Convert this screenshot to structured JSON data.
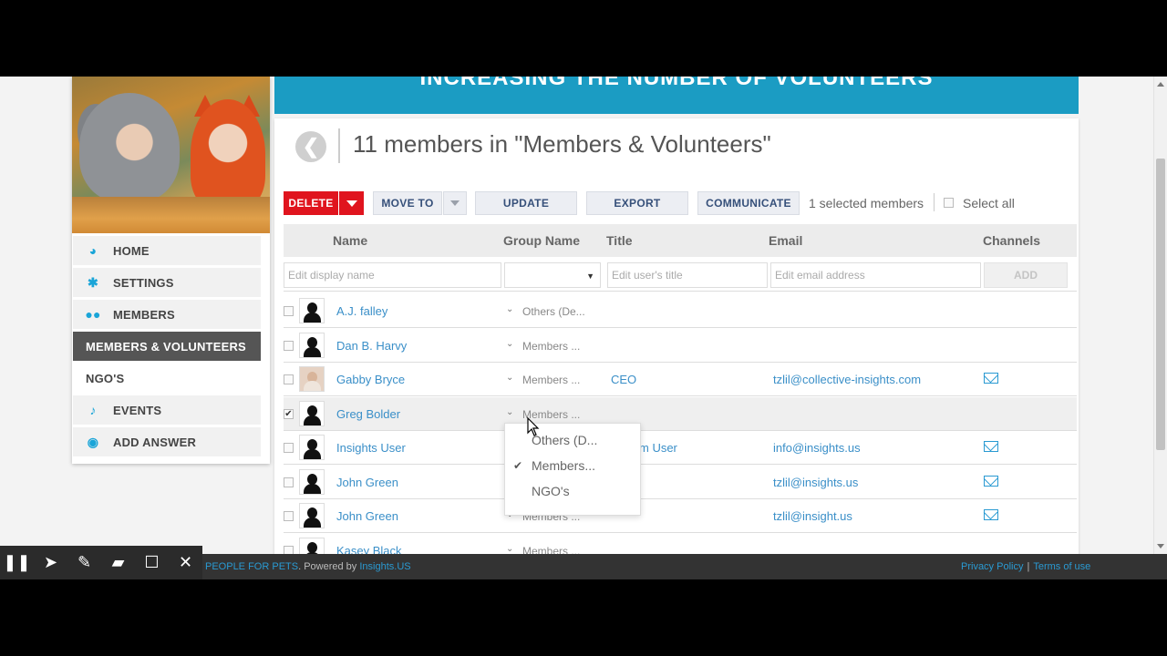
{
  "banner": {
    "title": "INCREASING THE NUMBER OF VOLUNTEERS"
  },
  "sidebar": {
    "items": [
      {
        "label": "HOME",
        "icon": "dashboard-icon",
        "active": false
      },
      {
        "label": "SETTINGS",
        "icon": "gear-icon",
        "active": false
      },
      {
        "label": "MEMBERS",
        "icon": "users-icon",
        "active": false
      },
      {
        "label": "MEMBERS & VOLUNTEERS",
        "icon": "",
        "active": true
      },
      {
        "label": "NGO'S",
        "icon": "",
        "active": false
      },
      {
        "label": "EVENTS",
        "icon": "microphone-icon",
        "active": false
      },
      {
        "label": "ADD ANSWER",
        "icon": "chat-icon",
        "active": false
      }
    ]
  },
  "panel": {
    "title": "11 members in \"Members & Volunteers\"",
    "toolbar": {
      "delete": "DELETE",
      "move_to": "MOVE TO",
      "update": "UPDATE",
      "export": "EXPORT",
      "communicate": "COMMUNICATE",
      "selected_count": "1 selected members",
      "select_all": "Select all"
    },
    "columns": {
      "name": "Name",
      "group": "Group Name",
      "title": "Title",
      "email": "Email",
      "channels": "Channels"
    },
    "edit_row": {
      "name_placeholder": "Edit display name",
      "title_placeholder": "Edit user's title",
      "email_placeholder": "Edit email address",
      "add": "ADD"
    },
    "rows": [
      {
        "name": "A.J. falley",
        "group": "Others (De...",
        "title": "",
        "email": "",
        "checked": false,
        "photo": false,
        "mail": false
      },
      {
        "name": "Dan B. Harvy",
        "group": "Members ...",
        "title": "",
        "email": "",
        "checked": false,
        "photo": false,
        "mail": false
      },
      {
        "name": "Gabby Bryce",
        "group": "Members ...",
        "title": "CEO",
        "email": "tzlil@collective-insights.com",
        "checked": false,
        "photo": true,
        "mail": true
      },
      {
        "name": "Greg Bolder",
        "group": "Members ...",
        "title": "",
        "email": "",
        "checked": true,
        "photo": false,
        "mail": false
      },
      {
        "name": "Insights User",
        "group": "",
        "title": "m User",
        "email": "info@insights.us",
        "checked": false,
        "photo": false,
        "mail": true
      },
      {
        "name": "John Green",
        "group": "",
        "title": "",
        "email": "tzlil@insights.us",
        "checked": false,
        "photo": false,
        "mail": true
      },
      {
        "name": "John Green",
        "group": "Members ...",
        "title": "",
        "email": "tzlil@insight.us",
        "checked": false,
        "photo": false,
        "mail": true
      },
      {
        "name": "Kasey Black",
        "group": "Members ...",
        "title": "",
        "email": "",
        "checked": false,
        "photo": false,
        "mail": false
      }
    ],
    "group_dropdown": {
      "options": [
        "Others (D...",
        "Members...",
        "NGO's"
      ],
      "selected": "Members..."
    }
  },
  "footer": {
    "org_link": "PEOPLE FOR PETS",
    "powered_by": ". Powered by ",
    "powered_link": "Insights.US",
    "privacy": "Privacy Policy",
    "separator": "|",
    "terms": "Terms of use"
  },
  "annotation_tools": [
    "pause-icon",
    "pointer-icon",
    "pen-icon",
    "highlighter-icon",
    "rectangle-icon",
    "close-icon"
  ],
  "colors": {
    "banner": "#1b9cc3",
    "delete": "#e0141e",
    "link": "#3a8fc8",
    "active_nav": "#555555",
    "icon_accent": "#1aa5d8"
  }
}
